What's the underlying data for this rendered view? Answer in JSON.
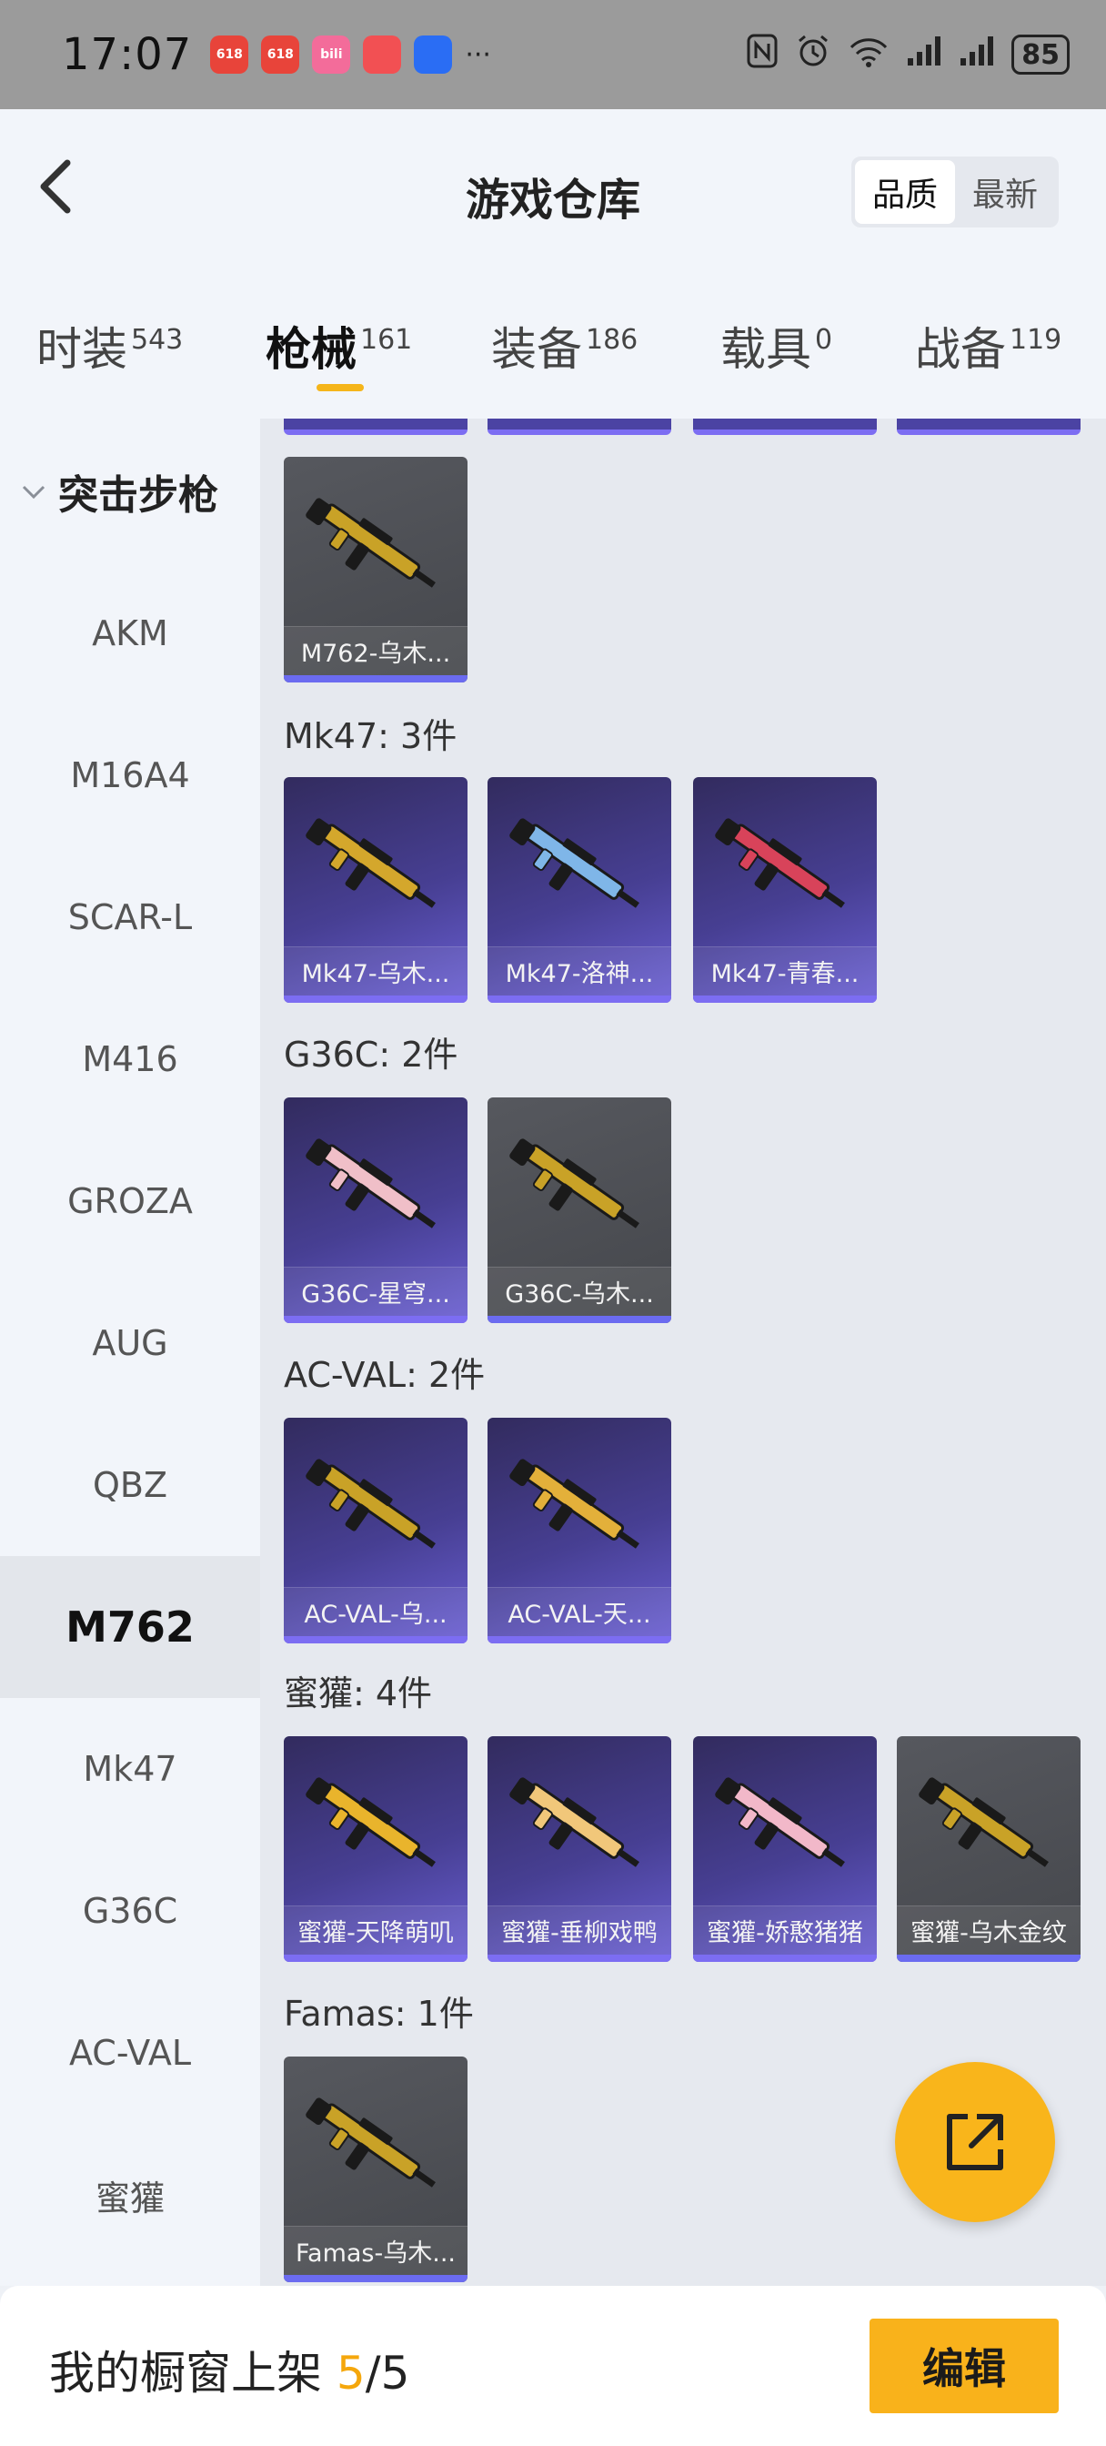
{
  "status_bar": {
    "time": "17:07",
    "app_icons": [
      {
        "label": "618",
        "color": "#e8443a"
      },
      {
        "label": "618",
        "color": "#e8443a"
      },
      {
        "label": "bili",
        "color": "#f36c9a"
      },
      {
        "label": "",
        "color": "#f25053"
      },
      {
        "label": "",
        "color": "#2a6df4"
      }
    ],
    "overflow": "···",
    "battery": "85"
  },
  "header": {
    "title": "游戏仓库",
    "sort_options": [
      "品质",
      "最新"
    ],
    "active_sort": "品质"
  },
  "tabs": [
    {
      "label": "时装",
      "count": "543"
    },
    {
      "label": "枪械",
      "count": "161"
    },
    {
      "label": "装备",
      "count": "186"
    },
    {
      "label": "载具",
      "count": "0"
    },
    {
      "label": "战备",
      "count": "119"
    }
  ],
  "active_tab": "枪械",
  "sidebar": {
    "section": "突击步枪",
    "items": [
      "AKM",
      "M16A4",
      "SCAR-L",
      "M416",
      "GROZA",
      "AUG",
      "QBZ",
      "M762",
      "Mk47",
      "G36C",
      "AC-VAL",
      "蜜獾"
    ],
    "active": "M762"
  },
  "groups": [
    {
      "title": "",
      "cards": [
        {
          "name": "M762-乌木...",
          "rarity": "gray",
          "color": "#c9a227"
        }
      ]
    },
    {
      "title": "Mk47: 3件",
      "cards": [
        {
          "name": "Mk47-乌木...",
          "rarity": "purple",
          "color": "#d4a72c"
        },
        {
          "name": "Mk47-洛神...",
          "rarity": "purple",
          "color": "#7fb6e8"
        },
        {
          "name": "Mk47-青春...",
          "rarity": "purple",
          "color": "#d8435a"
        }
      ]
    },
    {
      "title": "G36C: 2件",
      "cards": [
        {
          "name": "G36C-星穹...",
          "rarity": "purple",
          "color": "#f0bfc8"
        },
        {
          "name": "G36C-乌木...",
          "rarity": "gray",
          "color": "#c9a227"
        }
      ]
    },
    {
      "title": "AC-VAL: 2件",
      "cards": [
        {
          "name": "AC-VAL-乌...",
          "rarity": "purple",
          "color": "#c9a227"
        },
        {
          "name": "AC-VAL-天...",
          "rarity": "purple",
          "color": "#e3b03a"
        }
      ]
    },
    {
      "title": "蜜獾: 4件",
      "cards": [
        {
          "name": "蜜獾-天降萌叽",
          "rarity": "purple",
          "color": "#e9b42c"
        },
        {
          "name": "蜜獾-垂柳戏鸭",
          "rarity": "purple",
          "color": "#f1c77a"
        },
        {
          "name": "蜜獾-娇憨猪猪",
          "rarity": "purple",
          "color": "#f2b8c9"
        },
        {
          "name": "蜜獾-乌木金纹",
          "rarity": "gray",
          "color": "#c9a227"
        }
      ]
    },
    {
      "title": "Famas: 1件",
      "cards": [
        {
          "name": "Famas-乌木...",
          "rarity": "gray",
          "color": "#c9a227"
        }
      ]
    }
  ],
  "bottom_bar": {
    "label": "我的橱窗上架 ",
    "current": "5",
    "total": "/5",
    "edit_label": "编辑"
  }
}
